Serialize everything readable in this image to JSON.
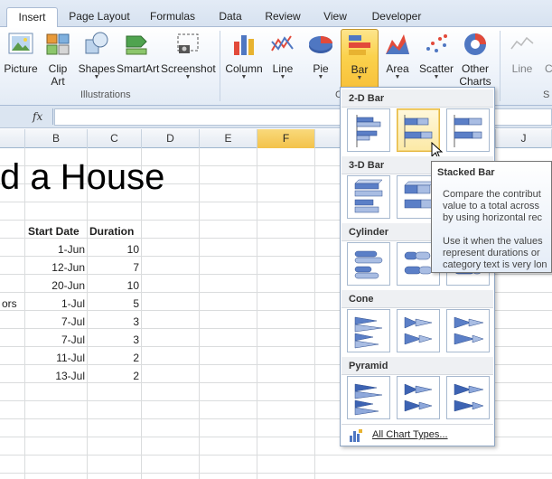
{
  "tabs": [
    "Insert",
    "Page Layout",
    "Formulas",
    "Data",
    "Review",
    "View",
    "Developer"
  ],
  "ribbon": {
    "illustrations": {
      "label": "Illustrations",
      "picture": "Picture",
      "clip_art_1": "Clip",
      "clip_art_2": "Art",
      "shapes": "Shapes",
      "smartart": "SmartArt",
      "screenshot": "Screenshot"
    },
    "charts": {
      "label_fragment": "C",
      "column": "Column",
      "line": "Line",
      "pie": "Pie",
      "bar": "Bar",
      "area": "Area",
      "scatter": "Scatter",
      "other_1": "Other",
      "other_2": "Charts"
    },
    "sparklines": {
      "line": "Line",
      "fragment": "C",
      "label_fragment": "S"
    }
  },
  "formula_bar": {
    "fx": "fx",
    "value": ""
  },
  "columns": [
    "B",
    "C",
    "D",
    "E",
    "F",
    "J"
  ],
  "sheet": {
    "title": "d a House",
    "headers": {
      "start": "Start Date",
      "duration": "Duration"
    },
    "row_label_fragment": "ors",
    "rows": [
      {
        "start": "1-Jun",
        "duration": "10"
      },
      {
        "start": "12-Jun",
        "duration": "7"
      },
      {
        "start": "20-Jun",
        "duration": "10"
      },
      {
        "start": "1-Jul",
        "duration": "5"
      },
      {
        "start": "7-Jul",
        "duration": "3"
      },
      {
        "start": "7-Jul",
        "duration": "3"
      },
      {
        "start": "11-Jul",
        "duration": "2"
      },
      {
        "start": "13-Jul",
        "duration": "2"
      }
    ]
  },
  "dropdown": {
    "sections": [
      "2-D Bar",
      "3-D Bar",
      "Cylinder",
      "Cone",
      "Pyramid"
    ],
    "all_chart_types": "All Chart Types..."
  },
  "tooltip": {
    "title": "Stacked Bar",
    "lines": [
      "Compare the contribut",
      "value to a total across",
      "by using horizontal rec",
      "",
      "Use it when the values",
      "represent durations or",
      "category text is very lon"
    ]
  },
  "colors": {
    "accent": "#fbd24d",
    "bar_blue": "#5b7fc7",
    "ribbon_bg": "#e3ebf6"
  }
}
